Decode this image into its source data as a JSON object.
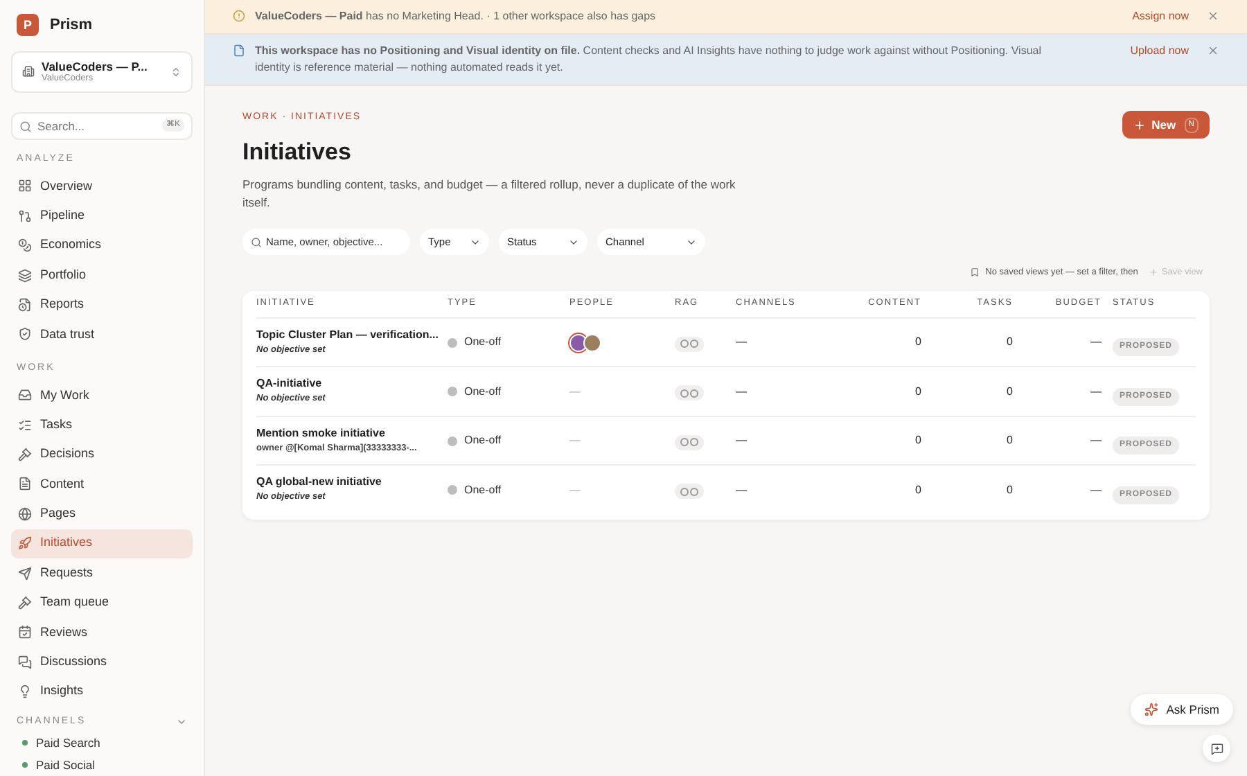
{
  "app": {
    "logo_letter": "P",
    "name": "Prism"
  },
  "workspace": {
    "name": "ValueCoders — P...",
    "sub": "ValueCoders"
  },
  "search": {
    "placeholder": "Search...",
    "shortcut": "⌘K"
  },
  "sidebar": [
    {
      "title": "ANALYZE",
      "items": [
        {
          "label": "Overview",
          "selected": false
        },
        {
          "label": "Pipeline",
          "selected": false
        },
        {
          "label": "Economics",
          "selected": false
        },
        {
          "label": "Portfolio",
          "selected": false
        },
        {
          "label": "Reports",
          "selected": false
        },
        {
          "label": "Data trust",
          "selected": false
        }
      ]
    },
    {
      "title": "WORK",
      "items": [
        {
          "label": "My Work",
          "selected": false
        },
        {
          "label": "Tasks",
          "selected": false
        },
        {
          "label": "Decisions",
          "selected": false
        },
        {
          "label": "Content",
          "selected": false
        },
        {
          "label": "Pages",
          "selected": false
        },
        {
          "label": "Initiatives",
          "selected": true
        },
        {
          "label": "Requests",
          "selected": false
        },
        {
          "label": "Team queue",
          "selected": false
        },
        {
          "label": "Reviews",
          "selected": false
        },
        {
          "label": "Discussions",
          "selected": false
        },
        {
          "label": "Insights",
          "selected": false
        }
      ]
    }
  ],
  "channels": {
    "title": "CHANNELS",
    "expanded": true,
    "items": [
      {
        "label": "Paid Search",
        "color": "#5a9a6e"
      },
      {
        "label": "Paid Social",
        "color": "#5a9a6e"
      }
    ]
  },
  "banners": [
    {
      "kind": "warning",
      "text": "**ValueCoders — Paid** has no Marketing Head. · 1 other workspace also has gaps",
      "action": "Assign now"
    },
    {
      "kind": "info",
      "text": "**This workspace has no Positioning and Visual identity on file.** Content checks and AI Insights have nothing to judge work against without Positioning. Visual identity is reference material — nothing automated reads it yet.",
      "action": "Upload now"
    }
  ],
  "breadcrumb": "WORK · INITIATIVES",
  "title": "Initiatives",
  "description": "Programs bundling content, tasks, and budget — a filtered rollup, never a duplicate of the work itself.",
  "new_button": {
    "label": "New",
    "shortcut": "N"
  },
  "filters": {
    "search_placeholder": "Name, owner, objective...",
    "dropdowns": [
      "Type",
      "Status",
      "Channel"
    ]
  },
  "saved_views": {
    "text": "No saved views yet — set a filter, then",
    "action": "Save view"
  },
  "table": {
    "columns": [
      "INITIATIVE",
      "TYPE",
      "PEOPLE",
      "RAG",
      "CHANNELS",
      "CONTENT",
      "TASKS",
      "BUDGET",
      "STATUS"
    ],
    "rows": [
      {
        "name": "Topic Cluster Plan — verification...",
        "sub": "No objective set",
        "sub_italic": true,
        "type": "One-off",
        "people": [
          {
            "color": "#8a5aa8"
          },
          {
            "color": "#9a8060"
          }
        ],
        "channels": "—",
        "content": "0",
        "tasks": "0",
        "budget": "—",
        "status": "PROPOSED"
      },
      {
        "name": "QA-initiative",
        "sub": "No objective set",
        "sub_italic": true,
        "type": "One-off",
        "people_empty": "—",
        "channels": "—",
        "content": "0",
        "tasks": "0",
        "budget": "—",
        "status": "PROPOSED"
      },
      {
        "name": "Mention smoke initiative",
        "sub": "owner @[Komal Sharma](33333333-...",
        "sub_italic": false,
        "type": "One-off",
        "people_empty": "—",
        "channels": "—",
        "content": "0",
        "tasks": "0",
        "budget": "—",
        "status": "PROPOSED"
      },
      {
        "name": "QA global-new initiative",
        "sub": "No objective set",
        "sub_italic": true,
        "type": "One-off",
        "people_empty": "—",
        "channels": "—",
        "content": "0",
        "tasks": "0",
        "budget": "—",
        "status": "PROPOSED"
      }
    ]
  },
  "ask": {
    "label": "Ask Prism"
  }
}
